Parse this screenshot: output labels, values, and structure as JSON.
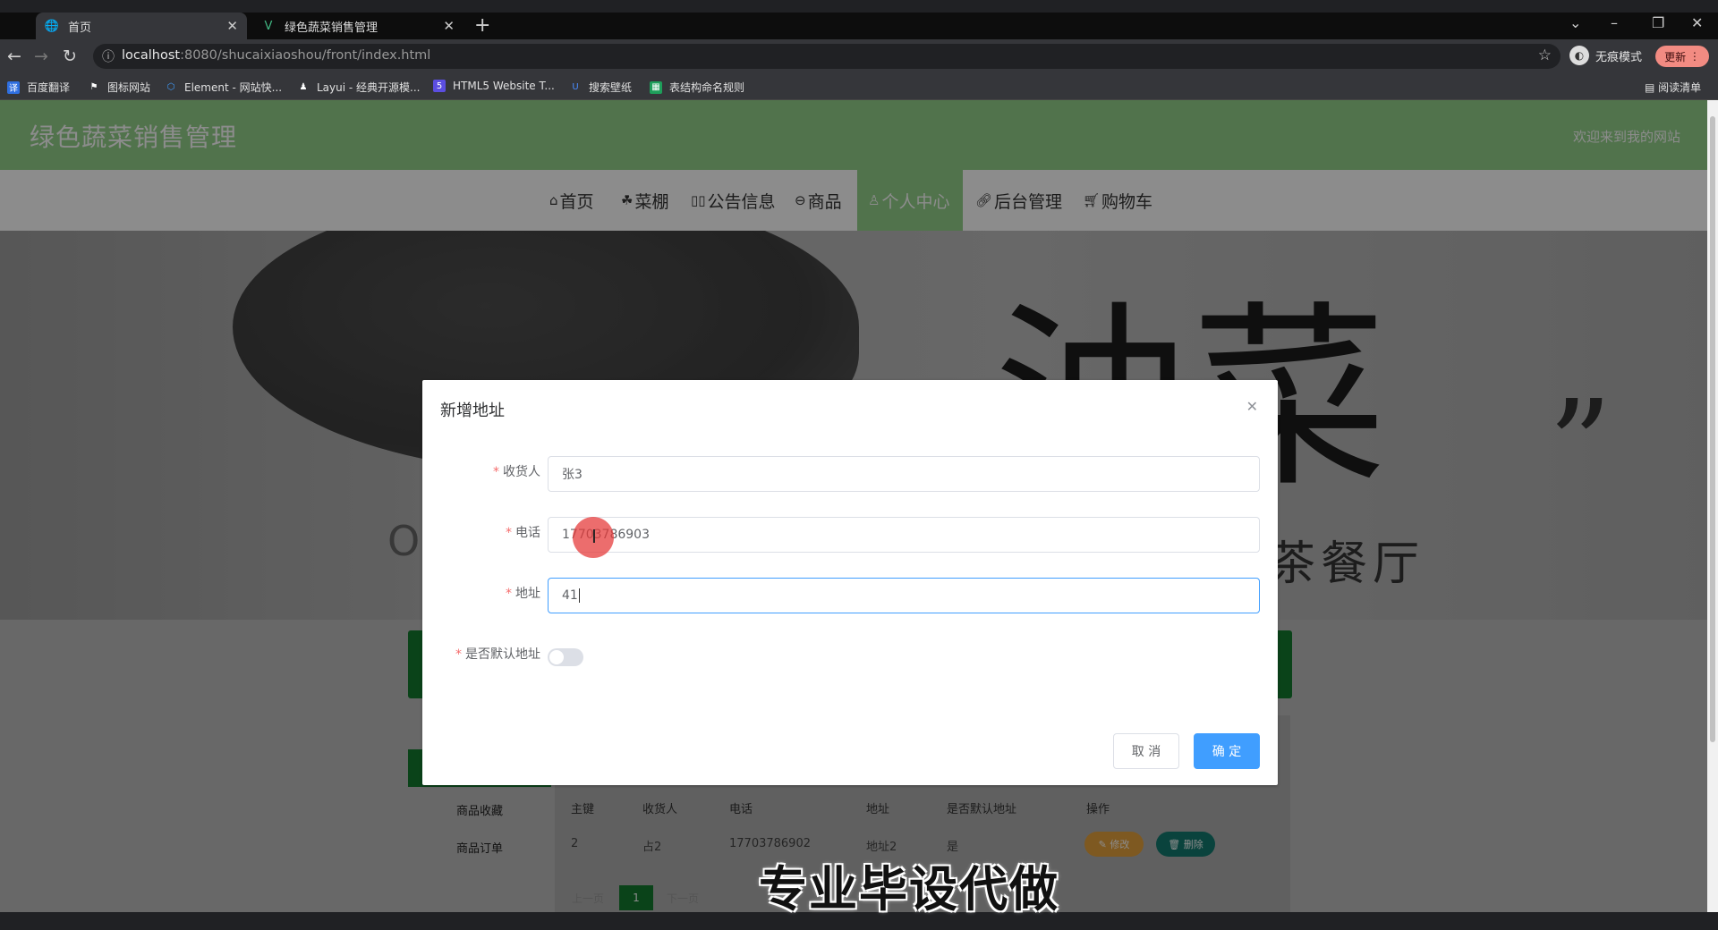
{
  "browser": {
    "tabs": [
      {
        "label": "首页",
        "active": true
      },
      {
        "label": "绿色蔬菜销售管理",
        "active": false
      }
    ],
    "url_host": "localhost",
    "url_rest": ":8080/shucaixiaoshou/front/index.html",
    "incognito_label": "无痕模式",
    "update_label": "更新",
    "reading_list_label": "阅读清单",
    "bookmarks": [
      "百度翻译",
      "图标网站",
      "Element - 网站快...",
      "Layui - 经典开源模...",
      "HTML5 Website T...",
      "搜索壁纸",
      "表结构命名规则"
    ]
  },
  "site": {
    "title": "绿色蔬菜销售管理",
    "welcome": "欢迎来到我的网站",
    "nav": [
      {
        "label": "首页",
        "icon": "home-icon"
      },
      {
        "label": "菜棚",
        "icon": "leaf-icon"
      },
      {
        "label": "公告信息",
        "icon": "notice-icon"
      },
      {
        "label": "商品",
        "icon": "goods-icon"
      },
      {
        "label": "个人中心",
        "icon": "user-icon",
        "active": true
      },
      {
        "label": "后台管理",
        "icon": "link-icon"
      },
      {
        "label": "购物车",
        "icon": "cart-icon"
      }
    ],
    "accent_color": "#94d18b"
  },
  "banner": {
    "big_text": "油菜",
    "quote": "”",
    "sub_text": "题茶餐厅",
    "left_o": "O"
  },
  "background_content": {
    "side_menu": [
      "商品收藏",
      "商品订单"
    ],
    "table_headers": [
      "主键",
      "收货人",
      "电话",
      "地址",
      "是否默认地址",
      "操作"
    ],
    "row": {
      "id": "2",
      "name": "占2",
      "phone": "17703786902",
      "address": "地址2",
      "default": "是"
    },
    "edit_label": "修改",
    "delete_label": "删除",
    "pager": [
      "上一页",
      "1",
      "下一页"
    ]
  },
  "dialog": {
    "title": "新增地址",
    "fields": [
      {
        "label": "收货人",
        "value": "张3"
      },
      {
        "label": "电话",
        "value": "17703786903"
      },
      {
        "label": "地址",
        "value": "41"
      },
      {
        "label": "是否默认地址",
        "value": ""
      }
    ],
    "default_switch_on": false,
    "cancel_label": "取 消",
    "ok_label": "确 定"
  },
  "watermark": "专业毕设代做"
}
